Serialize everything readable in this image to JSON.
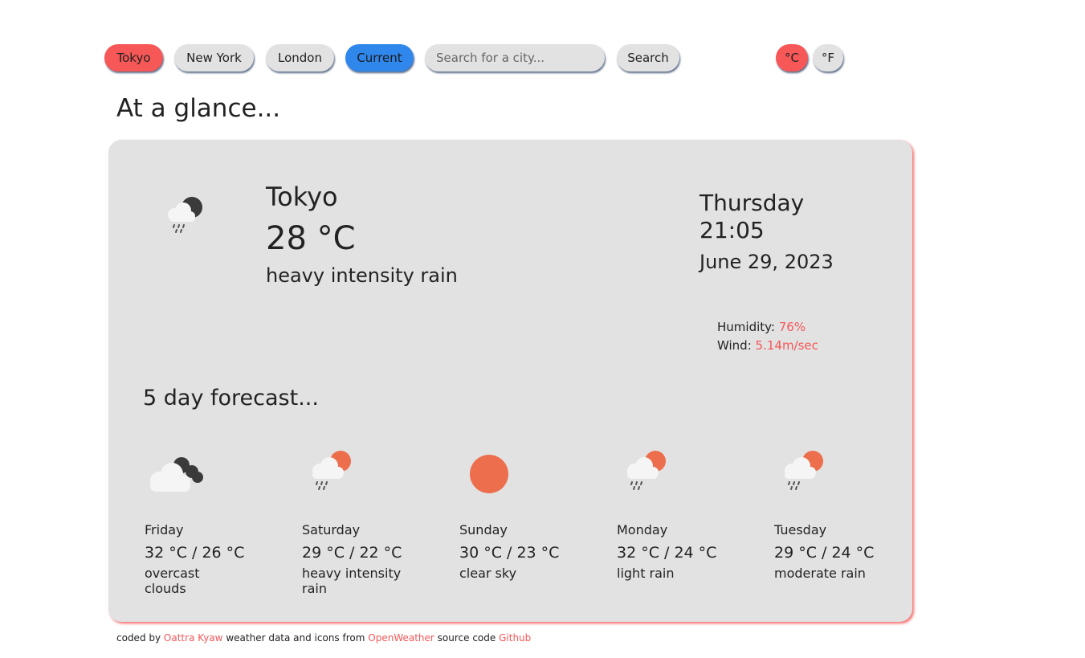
{
  "toolbar": {
    "cities": [
      "Tokyo",
      "New York",
      "London"
    ],
    "current_label": "Current",
    "search_placeholder": "Search for a city...",
    "search_label": "Search",
    "unit_c": "°C",
    "unit_f": "°F"
  },
  "glance_heading": "At a glance...",
  "current": {
    "icon": "rain-cloud-night-icon",
    "city": "Tokyo",
    "temp": "28 °C",
    "desc": "heavy intensity rain",
    "day": "Thursday",
    "time": "21:05",
    "date": "June 29, 2023",
    "humidity_label": "Humidity:",
    "humidity": "76%",
    "wind_label": "Wind:",
    "wind": "5.14m/sec"
  },
  "forecast_heading": "5 day forecast...",
  "forecast": [
    {
      "day": "Friday",
      "temps": "32 °C / 26 °C",
      "desc": "overcast clouds",
      "icon": "overcast-clouds-icon"
    },
    {
      "day": "Saturday",
      "temps": "29 °C / 22 °C",
      "desc": "heavy intensity rain",
      "icon": "rain-cloud-sun-icon"
    },
    {
      "day": "Sunday",
      "temps": "30 °C / 23 °C",
      "desc": "clear sky",
      "icon": "sun-icon"
    },
    {
      "day": "Monday",
      "temps": "32 °C / 24 °C",
      "desc": "light rain",
      "icon": "rain-cloud-sun-icon"
    },
    {
      "day": "Tuesday",
      "temps": "29 °C / 24 °C",
      "desc": "moderate rain",
      "icon": "rain-cloud-sun-icon"
    }
  ],
  "footer": {
    "coded_by": "coded by",
    "author": "Oattra Kyaw",
    "data_text": "weather data and icons from",
    "data_source": "OpenWeather",
    "source_text": "source code",
    "source_link": "Github"
  },
  "colors": {
    "accent_red": "#f65757",
    "accent_blue": "#2f86eb",
    "card_bg": "#e2e2e2",
    "sun": "#ec6e4c"
  }
}
